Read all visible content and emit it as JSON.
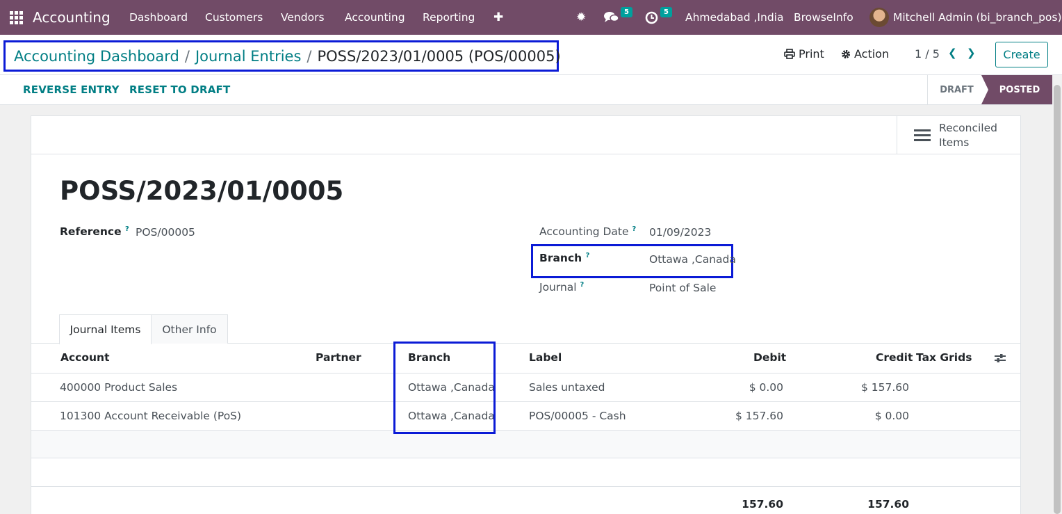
{
  "navbar": {
    "app_name": "Accounting",
    "menu": [
      "Dashboard",
      "Customers",
      "Vendors",
      "Accounting",
      "Reporting"
    ],
    "add_glyph": "✚",
    "bug_glyph": "✹",
    "messages_badge": "5",
    "activities_badge": "5",
    "company": "Ahmedabad ,India",
    "company2": "BrowseInfo",
    "user": "Mitchell Admin (bi_branch_pos)",
    "accent_color": "#714B67"
  },
  "breadcrumb": {
    "dashboard": "Accounting Dashboard",
    "sep": "/",
    "journal_entries": "Journal Entries",
    "current": "POSS/2023/01/0005 (POS/00005)"
  },
  "controls": {
    "print": "Print",
    "action": "Action",
    "pager": "1 / 5",
    "prev_glyph": "❮",
    "next_glyph": "❯",
    "create": "Create"
  },
  "statusbar": {
    "reverse": "REVERSE ENTRY",
    "reset": "RESET TO DRAFT",
    "stage_draft": "DRAFT",
    "stage_posted": "POSTED"
  },
  "smart_button": {
    "line1": "Reconciled",
    "line2": "Items"
  },
  "form": {
    "title": "POSS/2023/01/0005",
    "reference_label": "Reference",
    "reference_value": "POS/00005",
    "accounting_date_label": "Accounting Date",
    "accounting_date_value": "01/09/2023",
    "branch_label": "Branch",
    "branch_value": "Ottawa ,Canada",
    "journal_label": "Journal",
    "journal_value": "Point of Sale",
    "help_mark": "?"
  },
  "tabs": [
    "Journal Items",
    "Other Info"
  ],
  "table": {
    "headers": {
      "account": "Account",
      "partner": "Partner",
      "branch": "Branch",
      "label": "Label",
      "debit": "Debit",
      "credit": "Credit",
      "tax_grids": "Tax Grids"
    },
    "rows": [
      {
        "account": "400000 Product Sales",
        "partner": "",
        "branch": "Ottawa ,Canada",
        "label": "Sales untaxed",
        "debit": "$ 0.00",
        "credit": "$ 157.60"
      },
      {
        "account": "101300 Account Receivable (PoS)",
        "partner": "",
        "branch": "Ottawa ,Canada",
        "label": "POS/00005 - Cash",
        "debit": "$ 157.60",
        "credit": "$ 0.00"
      }
    ],
    "total_debit": "157.60",
    "total_credit": "157.60"
  }
}
